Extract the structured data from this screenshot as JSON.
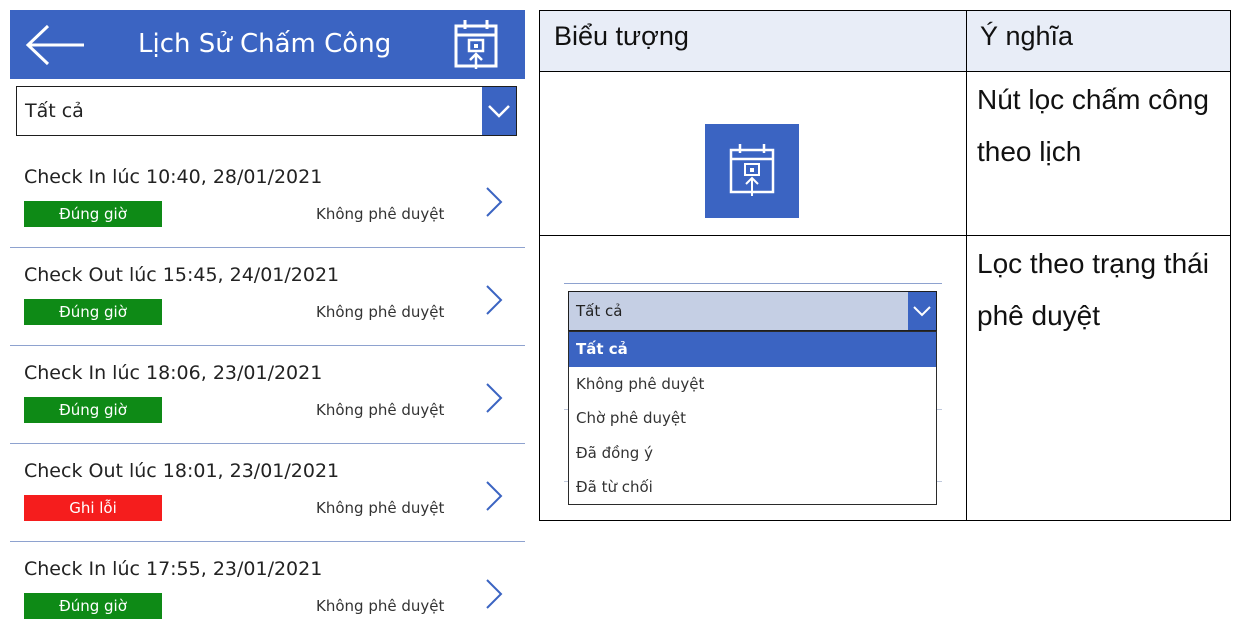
{
  "app": {
    "title": "Lịch Sử Chấm Công",
    "accent": "#3b64c2",
    "back_icon": "arrow-left-icon",
    "calendar_icon": "calendar-export-icon",
    "filter": {
      "value": "Tất cả",
      "icon": "chevron-down-icon"
    },
    "rows": [
      {
        "title": "Check In lúc 10:40, 28/01/2021",
        "badge": "Đúng giờ",
        "badge_color": "#0e8a16",
        "status": "Không phê duyệt"
      },
      {
        "title": "Check Out lúc 15:45, 24/01/2021",
        "badge": "Đúng giờ",
        "badge_color": "#0e8a16",
        "status": "Không phê duyệt"
      },
      {
        "title": "Check In lúc 18:06, 23/01/2021",
        "badge": "Đúng giờ",
        "badge_color": "#0e8a16",
        "status": "Không phê duyệt"
      },
      {
        "title": "Check Out lúc 18:01, 23/01/2021",
        "badge": "Ghi lỗi",
        "badge_color": "#f51d1d",
        "status": "Không phê duyệt"
      },
      {
        "title": "Check In lúc 17:55, 23/01/2021",
        "badge": "Đúng giờ",
        "badge_color": "#0e8a16",
        "status": "Không phê duyệt"
      }
    ]
  },
  "legend": {
    "headers": [
      "Biểu tượng",
      "Ý nghĩa"
    ],
    "rows": [
      {
        "meaning": "Nút lọc chấm công theo lịch"
      },
      {
        "meaning": "Lọc theo trạng thái phê duyệt",
        "dropdown": {
          "value": "Tất cả",
          "options": [
            "Tất cả",
            "Không phê duyệt",
            "Chờ phê duyệt",
            "Đã đồng ý",
            "Đã từ chối"
          ],
          "selected": "Tất cả"
        }
      }
    ]
  }
}
